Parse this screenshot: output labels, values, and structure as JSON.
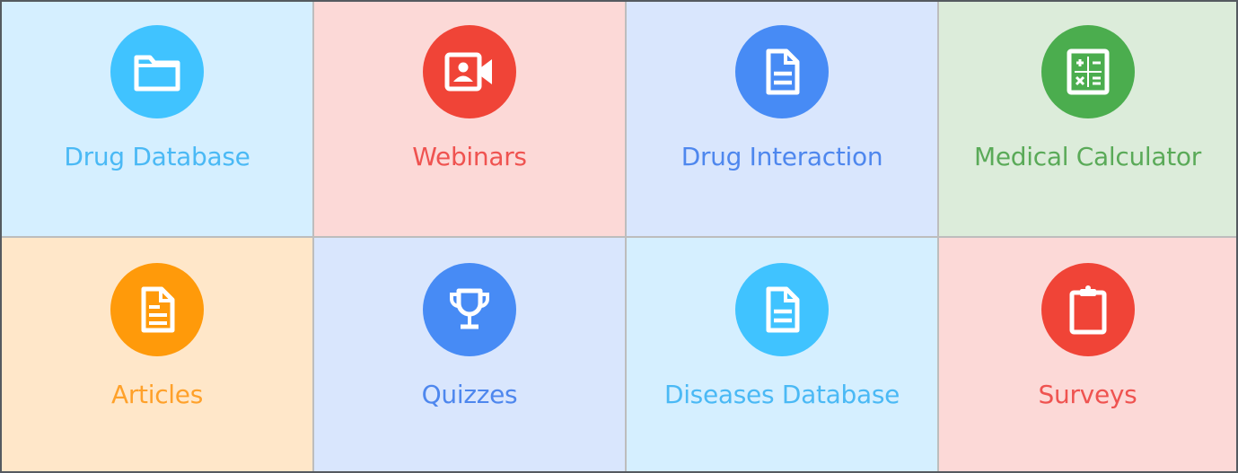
{
  "tiles": [
    {
      "label": "Drug Database",
      "icon": "folder-icon",
      "bg": "#d5efff",
      "accent": "#40c3ff",
      "text": "#4ab9f5"
    },
    {
      "label": "Webinars",
      "icon": "video-camera-icon",
      "bg": "#fcd9d7",
      "accent": "#f04437",
      "text": "#ef5350"
    },
    {
      "label": "Drug Interaction",
      "icon": "document-icon",
      "bg": "#d9e6fd",
      "accent": "#478bf5",
      "text": "#4e87ee"
    },
    {
      "label": "Medical Calculator",
      "icon": "calculator-icon",
      "bg": "#dcecda",
      "accent": "#4bad4e",
      "text": "#5aaa58"
    },
    {
      "label": "Articles",
      "icon": "article-icon",
      "bg": "#ffe7c9",
      "accent": "#ff9a0a",
      "text": "#ffa12a"
    },
    {
      "label": "Quizzes",
      "icon": "trophy-icon",
      "bg": "#d9e6fd",
      "accent": "#478bf5",
      "text": "#4e87ee"
    },
    {
      "label": "Diseases Database",
      "icon": "document-icon",
      "bg": "#d5efff",
      "accent": "#40c3ff",
      "text": "#4ab9f5"
    },
    {
      "label": "Surveys",
      "icon": "clipboard-icon",
      "bg": "#fcd9d7",
      "accent": "#f04437",
      "text": "#ef5350"
    }
  ]
}
